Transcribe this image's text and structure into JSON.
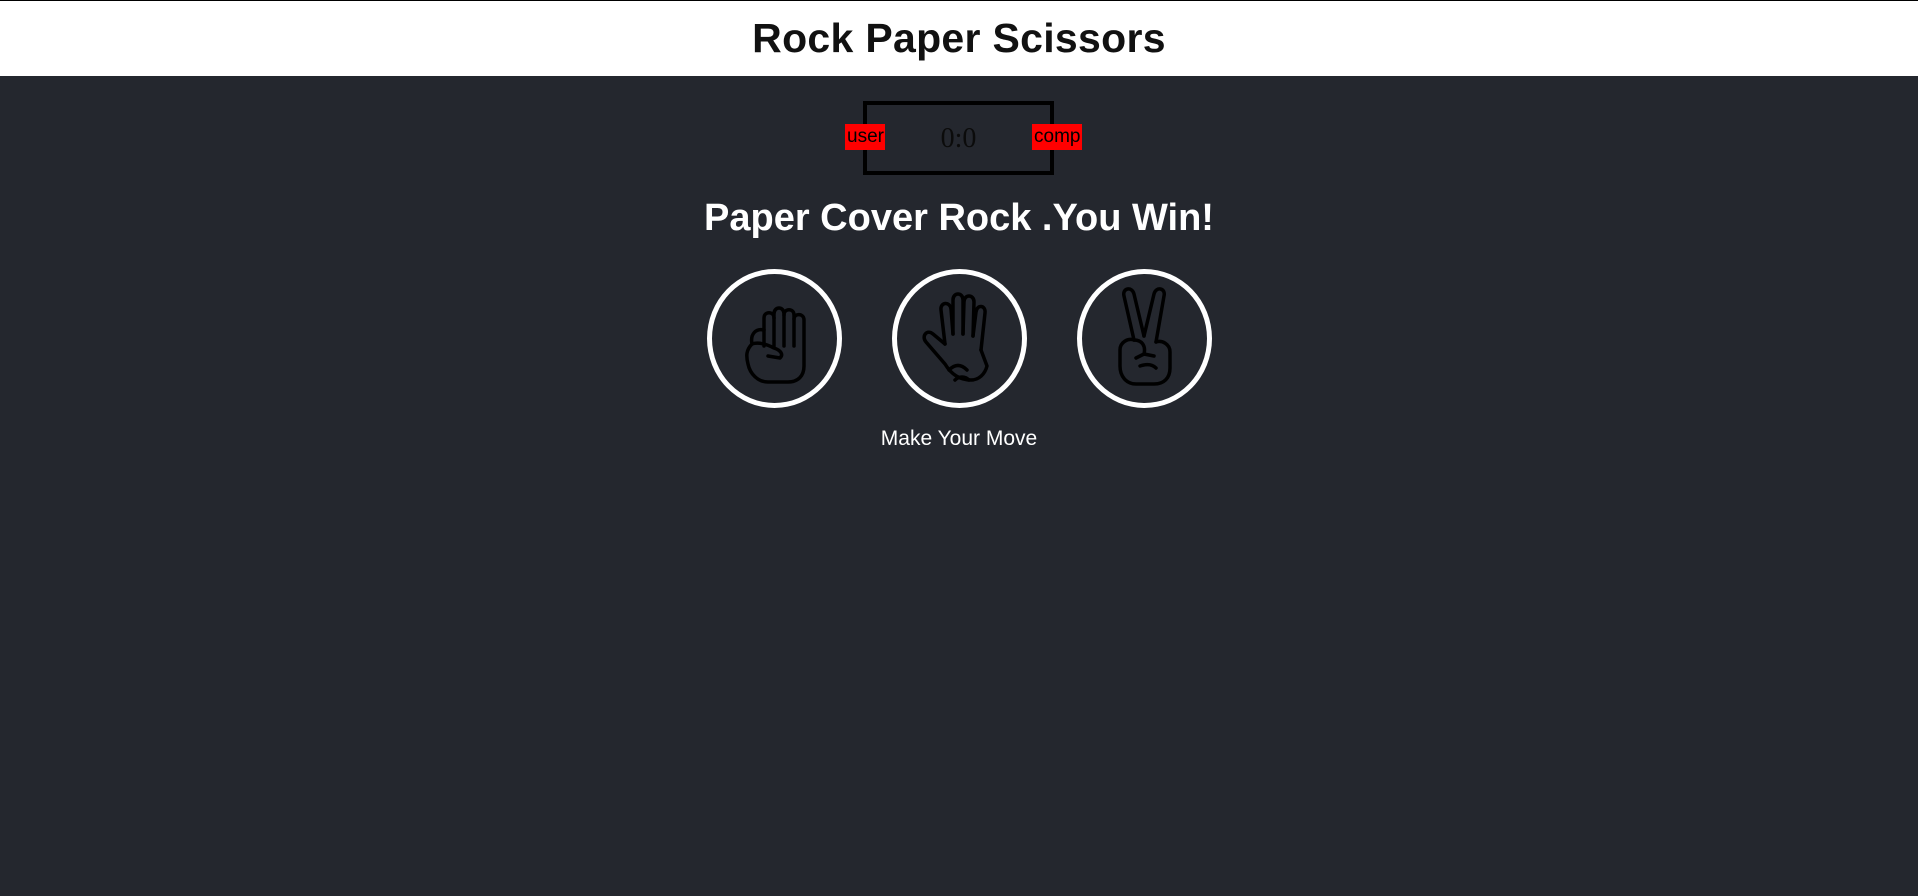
{
  "header": {
    "title": "Rock Paper Scissors"
  },
  "scoreboard": {
    "user_label": "user",
    "comp_label": "comp",
    "score": "0:0"
  },
  "result": {
    "message": "Paper Cover Rock .You Win!"
  },
  "choices": [
    {
      "id": "rock",
      "icon": "rock-hand-icon"
    },
    {
      "id": "paper",
      "icon": "paper-hand-icon"
    },
    {
      "id": "scissors",
      "icon": "scissors-hand-icon"
    }
  ],
  "action": {
    "message": "Make Your Move"
  },
  "colors": {
    "background": "#24272e",
    "header_bg": "#ffffff",
    "badge": "#ff0000",
    "circle_border": "#ffffff"
  }
}
